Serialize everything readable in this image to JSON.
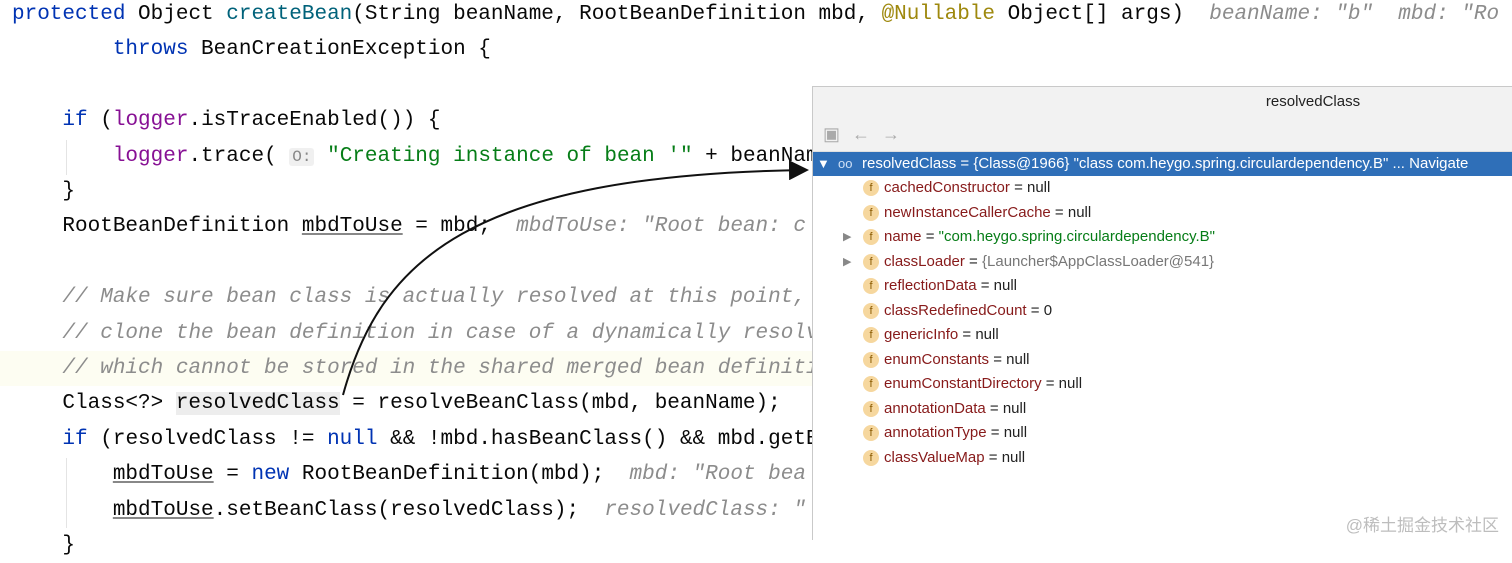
{
  "code": {
    "lines": [
      {
        "row": 0,
        "tokens": [
          [
            "kw",
            "protected "
          ],
          [
            "",
            "Object "
          ],
          [
            "fn",
            "createBean"
          ],
          [
            "",
            "(String beanName, RootBeanDefinition mbd, "
          ],
          [
            "ann",
            "@Nullable"
          ],
          [
            "",
            " Object[] args)  "
          ],
          [
            "hint",
            "beanName: \"b\"  mbd: \"Ro"
          ]
        ]
      },
      {
        "row": 1,
        "tokens": [
          [
            "",
            "        "
          ],
          [
            "kw",
            "throws "
          ],
          [
            "",
            "BeanCreationException {"
          ]
        ]
      },
      {
        "row": 3,
        "tokens": [
          [
            "",
            "    "
          ],
          [
            "kw",
            "if "
          ],
          [
            "",
            "("
          ],
          [
            "fld",
            "logger"
          ],
          [
            "",
            ".isTraceEnabled()) {"
          ]
        ]
      },
      {
        "row": 4,
        "tokens": [
          [
            "",
            "        "
          ],
          [
            "fld",
            "logger"
          ],
          [
            "",
            ".trace( "
          ],
          [
            "inlay",
            "O:"
          ],
          [
            "",
            " "
          ],
          [
            "str",
            "\"Creating instance of bean '\""
          ],
          [
            "",
            " + beanName"
          ]
        ]
      },
      {
        "row": 5,
        "tokens": [
          [
            "",
            "    }"
          ]
        ]
      },
      {
        "row": 6,
        "tokens": [
          [
            "",
            "    RootBeanDefinition "
          ],
          [
            "ul",
            "mbdToUse"
          ],
          [
            "",
            " = mbd;  "
          ],
          [
            "hint",
            "mbdToUse: \"Root bean: c"
          ]
        ]
      },
      {
        "row": 8,
        "tokens": [
          [
            "",
            "    "
          ],
          [
            "cmt",
            "// Make sure bean class is actually resolved at this point, and"
          ]
        ]
      },
      {
        "row": 9,
        "tokens": [
          [
            "",
            "    "
          ],
          [
            "cmt",
            "// clone the bean definition in case of a dynamically resolved"
          ]
        ]
      },
      {
        "row": 10,
        "tokens": [
          [
            "",
            "    "
          ],
          [
            "cmt",
            "// which cannot be stored in the shared merged bean definition."
          ]
        ]
      },
      {
        "row": 11,
        "tokens": [
          [
            "",
            "    Class<?> "
          ],
          [
            "sel",
            "resolvedClass"
          ],
          [
            "",
            " = resolveBeanClass(mbd, beanName);"
          ]
        ]
      },
      {
        "row": 12,
        "tokens": [
          [
            "",
            "    "
          ],
          [
            "kw",
            "if "
          ],
          [
            "",
            "(resolvedClass != "
          ],
          [
            "kw",
            "null"
          ],
          [
            "",
            " && !mbd.hasBeanClass() && mbd.getBe"
          ]
        ]
      },
      {
        "row": 13,
        "tokens": [
          [
            "",
            "        "
          ],
          [
            "ul",
            "mbdToUse"
          ],
          [
            "",
            " = "
          ],
          [
            "kw",
            "new "
          ],
          [
            "",
            "RootBeanDefinition(mbd);  "
          ],
          [
            "hint",
            "mbd: \"Root bea"
          ]
        ]
      },
      {
        "row": 14,
        "tokens": [
          [
            "",
            "        "
          ],
          [
            "ul",
            "mbdToUse"
          ],
          [
            "",
            ".setBeanClass(resolvedClass);  "
          ],
          [
            "hint",
            "resolvedClass: \""
          ]
        ]
      },
      {
        "row": 15,
        "tokens": [
          [
            "",
            "    }"
          ]
        ]
      }
    ]
  },
  "popup": {
    "title": "resolvedClass",
    "toolbar": {
      "icons": [
        "frame-icon",
        "back-arrow-icon",
        "forward-arrow-icon"
      ],
      "back": "←",
      "forward": "→"
    },
    "root": {
      "name": "resolvedClass",
      "value": " = {Class@1966} \"class com.heygo.spring.circulardependency.B\" ... ",
      "navigate": "Navigate"
    },
    "fields": [
      {
        "name": "cachedConstructor",
        "value": " = null",
        "type": "plain",
        "expandable": false
      },
      {
        "name": "newInstanceCallerCache",
        "value": " = null",
        "type": "plain",
        "expandable": false
      },
      {
        "name": "name",
        "value": "\"com.heygo.spring.circulardependency.B\"",
        "type": "string",
        "expandable": true
      },
      {
        "name": "classLoader",
        "value": "{Launcher$AppClassLoader@541}",
        "type": "grey",
        "expandable": true
      },
      {
        "name": "reflectionData",
        "value": " = null",
        "type": "plain",
        "expandable": false
      },
      {
        "name": "classRedefinedCount",
        "value": " = 0",
        "type": "plain",
        "expandable": false
      },
      {
        "name": "genericInfo",
        "value": " = null",
        "type": "plain",
        "expandable": false
      },
      {
        "name": "enumConstants",
        "value": " = null",
        "type": "plain",
        "expandable": false
      },
      {
        "name": "enumConstantDirectory",
        "value": " = null",
        "type": "plain",
        "expandable": false
      },
      {
        "name": "annotationData",
        "value": " = null",
        "type": "plain",
        "expandable": false
      },
      {
        "name": "annotationType",
        "value": " = null",
        "type": "plain",
        "expandable": false
      },
      {
        "name": "classValueMap",
        "value": " = null",
        "type": "plain",
        "expandable": false
      }
    ]
  },
  "watermark": "@稀土掘金技术社区"
}
